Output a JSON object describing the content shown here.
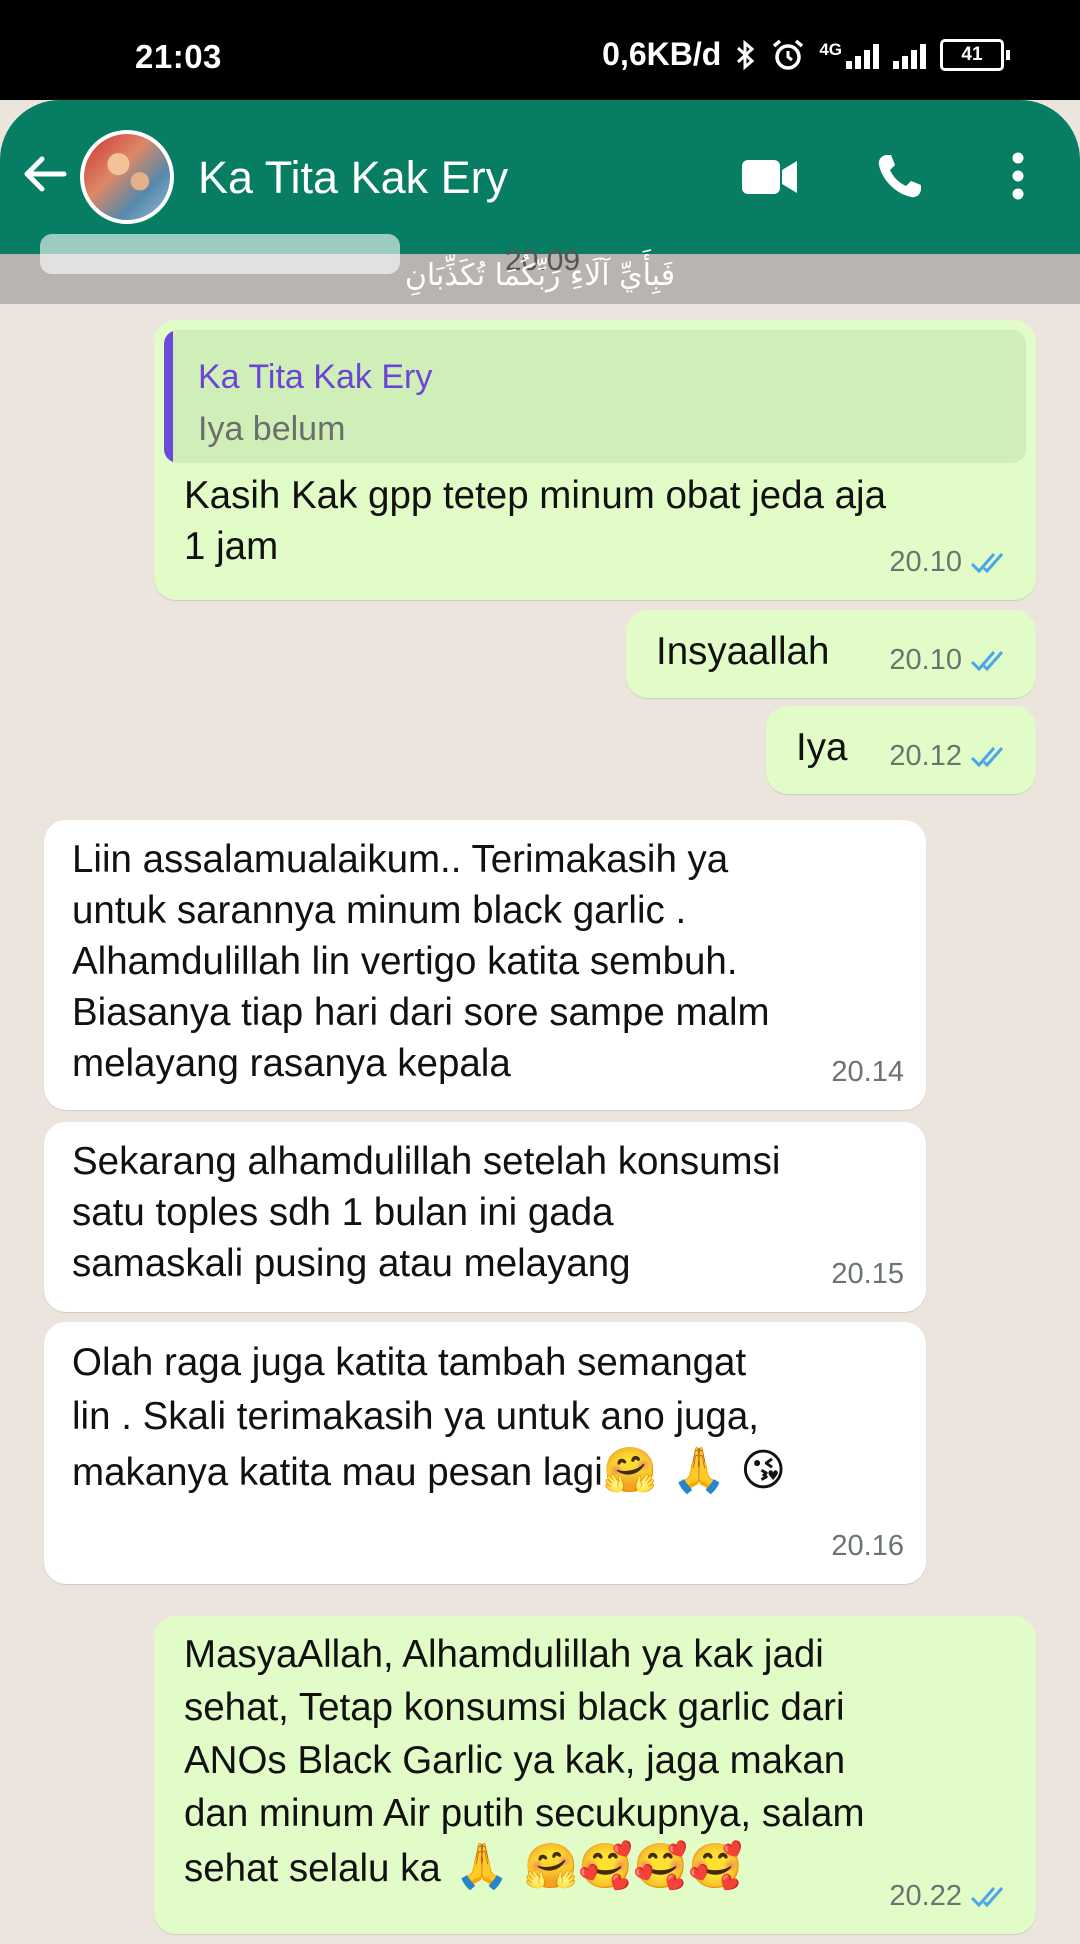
{
  "status": {
    "time": "21:03",
    "network_speed": "0,6KB/d",
    "network_type": "4G",
    "battery": "41",
    "icons": [
      "bluetooth-icon",
      "alarm-icon",
      "signal-icon",
      "signal-icon",
      "battery-icon"
    ]
  },
  "header": {
    "contact_name": "Ka Tita Kak Ery",
    "icons": [
      "back-arrow-icon",
      "video-call-icon",
      "phone-icon",
      "more-vert-icon"
    ],
    "color": "#077d64"
  },
  "overlay": {
    "arabic_text": "فَبِأَيِّ آلَاءِ رَبِّكُمَا تُكَذِّبَانِ",
    "ghost_time": "20.09"
  },
  "messages": [
    {
      "direction": "out",
      "quote": {
        "name": "Ka Tita Kak Ery",
        "text": "Iya belum"
      },
      "text": "Kasih Kak gpp tetep minum obat jeda aja\n1 jam",
      "time": "20.10",
      "read": true
    },
    {
      "direction": "out",
      "text": "Insyaallah",
      "time": "20.10",
      "read": true
    },
    {
      "direction": "out",
      "text": "Iya",
      "time": "20.12",
      "read": true
    },
    {
      "direction": "in",
      "text": "Liin assalamualaikum.. Terimakasih ya\nuntuk sarannya minum black garlic .\nAlhamdulillah lin vertigo katita sembuh.\nBiasanya tiap hari dari sore sampe malm\nmelayang rasanya kepala",
      "time": "20.14"
    },
    {
      "direction": "in",
      "text": "Sekarang alhamdulillah setelah konsumsi\nsatu toples sdh 1 bulan ini gada\nsamaskali pusing atau melayang",
      "time": "20.15"
    },
    {
      "direction": "in",
      "text": "Olah raga juga katita tambah semangat\nlin . Skali terimakasih ya untuk ano juga,\nmakanya katita mau pesan lagi",
      "emojis": "🤗 🙏 😘",
      "time": "20.16"
    },
    {
      "direction": "out",
      "text": "MasyaAllah, Alhamdulillah ya kak jadi\nsehat, Tetap konsumsi black garlic dari\nANOs Black Garlic ya kak, jaga makan\ndan minum Air putih secukupnya, salam\nsehat selalu ka",
      "emojis": " 🙏 🤗🥰🥰🥰",
      "time": "20.22",
      "read": true
    }
  ]
}
